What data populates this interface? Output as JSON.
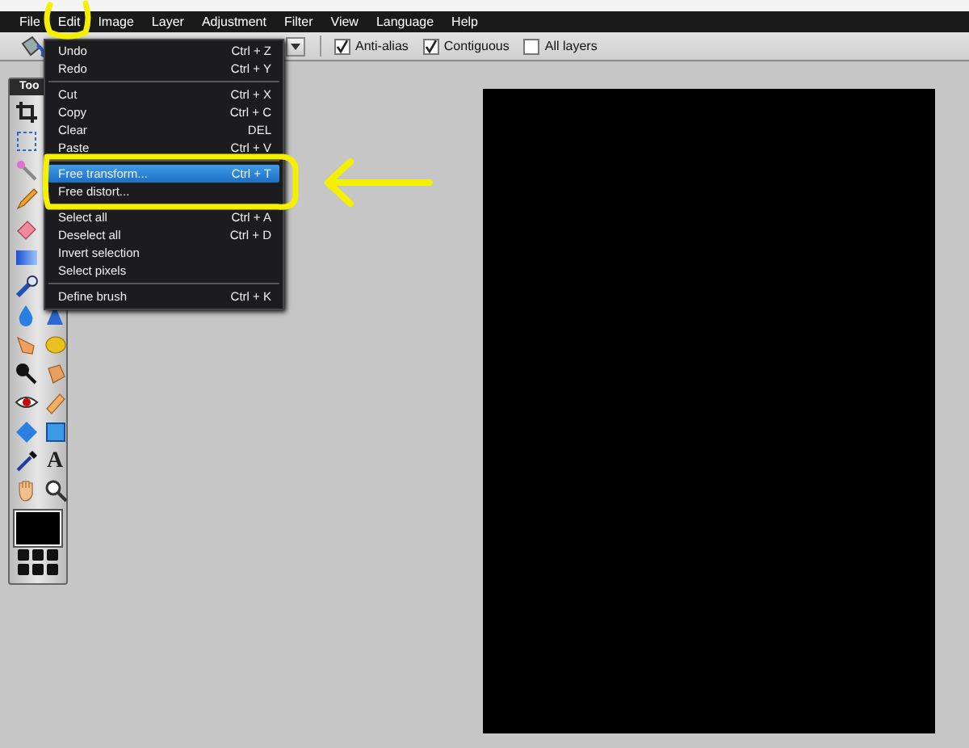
{
  "menubar": [
    {
      "label": "File"
    },
    {
      "label": "Edit"
    },
    {
      "label": "Image"
    },
    {
      "label": "Layer"
    },
    {
      "label": "Adjustment"
    },
    {
      "label": "Filter"
    },
    {
      "label": "View"
    },
    {
      "label": "Language"
    },
    {
      "label": "Help"
    }
  ],
  "toolbar": {
    "options": [
      {
        "label": "Anti-alias",
        "checked": true
      },
      {
        "label": "Contiguous",
        "checked": true
      },
      {
        "label": "All layers",
        "checked": false
      }
    ]
  },
  "edit_menu": {
    "items": [
      {
        "kind": "item",
        "label": "Undo",
        "shortcut": "Ctrl + Z",
        "selected": false
      },
      {
        "kind": "item",
        "label": "Redo",
        "shortcut": "Ctrl + Y",
        "selected": false
      },
      {
        "kind": "separator"
      },
      {
        "kind": "item",
        "label": "Cut",
        "shortcut": "Ctrl + X",
        "selected": false
      },
      {
        "kind": "item",
        "label": "Copy",
        "shortcut": "Ctrl + C",
        "selected": false
      },
      {
        "kind": "item",
        "label": "Clear",
        "shortcut": "DEL",
        "selected": false
      },
      {
        "kind": "item",
        "label": "Paste",
        "shortcut": "Ctrl + V",
        "selected": false
      },
      {
        "kind": "separator"
      },
      {
        "kind": "item",
        "label": "Free transform...",
        "shortcut": "Ctrl + T",
        "selected": true
      },
      {
        "kind": "item",
        "label": "Free distort...",
        "selected": false
      },
      {
        "kind": "separator"
      },
      {
        "kind": "item",
        "label": "Select all",
        "shortcut": "Ctrl + A",
        "selected": false
      },
      {
        "kind": "item",
        "label": "Deselect all",
        "shortcut": "Ctrl + D",
        "selected": false
      },
      {
        "kind": "item",
        "label": "Invert selection",
        "selected": false
      },
      {
        "kind": "item",
        "label": "Select pixels",
        "selected": false
      },
      {
        "kind": "separator"
      },
      {
        "kind": "item",
        "label": "Define brush",
        "shortcut": "Ctrl + K",
        "selected": false
      }
    ]
  },
  "toolbox": {
    "title": "Too",
    "text_tool": "A"
  }
}
